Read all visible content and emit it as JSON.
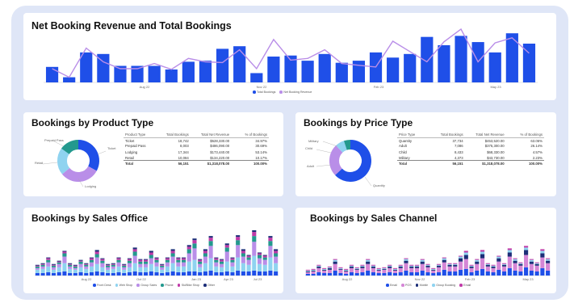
{
  "colors": {
    "blue": "#1f4fe8",
    "lavender": "#b98ee8",
    "teal": "#23998e",
    "lightblue": "#8fd3f0",
    "magenta": "#c03aa8",
    "navy": "#1c2e78",
    "orchid": "#d586d6"
  },
  "revenue": {
    "title": "Net Booking Revenue and Total Bookings",
    "y_left": [
      "",
      ""
    ],
    "y_right": [
      "",
      "",
      ""
    ],
    "x_ticks": [
      "Aug 22",
      "Nov 22",
      "Feb 23",
      "May 23"
    ],
    "legend": [
      "Total Bookings",
      "Net Booking Revenue"
    ],
    "chart_data": {
      "type": "bar",
      "series": [
        {
          "name": "Total Bookings",
          "values": [
            30,
            10,
            58,
            55,
            32,
            32,
            32,
            25,
            40,
            42,
            65,
            70,
            18,
            50,
            52,
            42,
            55,
            38,
            42,
            58,
            48,
            55,
            88,
            72,
            90,
            78,
            58,
            95,
            75
          ]
        },
        {
          "name": "Net Booking Revenue",
          "values": [
            40,
            15,
            100,
            60,
            40,
            40,
            55,
            38,
            70,
            60,
            58,
            95,
            40,
            125,
            65,
            70,
            95,
            55,
            50,
            45,
            120,
            90,
            60,
            118,
            155,
            60,
            115,
            130,
            85
          ]
        }
      ]
    }
  },
  "product": {
    "title": "Bookings by Product Type",
    "headers": [
      "Product Type",
      "Total Bookings",
      "Total Net Revenue",
      "% of Bookings"
    ],
    "rows": [
      [
        "Ticket",
        "18,742",
        "$528,330.00",
        "34.97%"
      ],
      [
        "Prepaid Pass",
        "8,003",
        "$486,090.00",
        "30.69%"
      ],
      [
        "Lodging",
        "17,344",
        "$173,440.00",
        "53.14%"
      ],
      [
        "Retail",
        "10,084",
        "$134,220.00",
        "10.17%"
      ]
    ],
    "total": [
      "Total",
      "56,151",
      "$1,318,078.00",
      "100.00%"
    ],
    "donut_labels": [
      "Prepaid Pass",
      "Ticket",
      "Retail",
      "Lodging"
    ],
    "chart_data": {
      "type": "pie",
      "categories": [
        "Ticket",
        "Lodging",
        "Retail",
        "Prepaid Pass"
      ],
      "values": [
        33,
        31,
        21,
        15
      ]
    }
  },
  "price": {
    "title": "Bookings by Price Type",
    "headers": [
      "Price Type",
      "Total Bookings",
      "Total Net Revenue",
      "% of Bookings"
    ],
    "rows": [
      [
        "Quantity",
        "37,734",
        "$453,520.00",
        "63.06%"
      ],
      [
        "Adult",
        "7,086",
        "$375,300.00",
        "26.14%"
      ],
      [
        "Child",
        "8,433",
        "$68,330.00",
        "4.57%"
      ],
      [
        "Military",
        "4,373",
        "$43,730.00",
        "2.23%"
      ]
    ],
    "total": [
      "Total",
      "56,151",
      "$1,318,078.00",
      "100.00%"
    ],
    "donut_labels": [
      "Military",
      "Child",
      "Adult",
      "Quantity"
    ],
    "chart_data": {
      "type": "pie",
      "categories": [
        "Quantity",
        "Adult",
        "Child",
        "Military"
      ],
      "values": [
        63,
        25,
        7,
        5
      ]
    }
  },
  "office": {
    "title": "Bookings by Sales Office",
    "y_ticks": [
      "",
      "",
      ""
    ],
    "x_ticks": [
      "Aug 22",
      "Oct 22",
      "Jan 23",
      "Apr 23",
      "Jul 23"
    ],
    "legend": [
      "Front Desk",
      "Web Shop",
      "Group Sales",
      "Phone",
      "Ski/Bike Shop",
      "Other"
    ],
    "chart_data": {
      "type": "bar",
      "stacked": true,
      "categories_count": 45,
      "series": [
        {
          "name": "Front Desk",
          "values": [
            3,
            3,
            4,
            3,
            4,
            5,
            3,
            3,
            4,
            3,
            4,
            5,
            4,
            3,
            3,
            4,
            3,
            4,
            5,
            4,
            4,
            5,
            4,
            3,
            4,
            5,
            4,
            4,
            5,
            5,
            4,
            5,
            6,
            4,
            4,
            5,
            4,
            6,
            5,
            5,
            6,
            5,
            5,
            6,
            5
          ]
        },
        {
          "name": "Web Shop",
          "values": [
            4,
            5,
            7,
            4,
            6,
            10,
            5,
            4,
            6,
            5,
            7,
            9,
            6,
            4,
            5,
            7,
            4,
            6,
            10,
            6,
            6,
            9,
            7,
            4,
            7,
            10,
            7,
            7,
            12,
            14,
            6,
            10,
            15,
            7,
            6,
            12,
            7,
            16,
            10,
            8,
            18,
            9,
            8,
            16,
            10
          ]
        },
        {
          "name": "Group Sales",
          "values": [
            2,
            3,
            5,
            3,
            4,
            8,
            3,
            2,
            4,
            3,
            5,
            8,
            5,
            3,
            3,
            5,
            3,
            5,
            9,
            4,
            4,
            7,
            5,
            3,
            5,
            8,
            5,
            5,
            10,
            14,
            4,
            8,
            15,
            5,
            4,
            12,
            5,
            15,
            8,
            6,
            17,
            7,
            6,
            14,
            8
          ]
        },
        {
          "name": "Phone",
          "values": [
            2,
            2,
            3,
            2,
            2,
            4,
            2,
            2,
            3,
            2,
            3,
            4,
            3,
            2,
            2,
            3,
            2,
            3,
            5,
            3,
            3,
            4,
            3,
            2,
            3,
            4,
            3,
            3,
            5,
            6,
            3,
            4,
            6,
            3,
            3,
            5,
            3,
            6,
            4,
            3,
            7,
            4,
            3,
            6,
            4
          ]
        },
        {
          "name": "Ski/Bike Shop",
          "values": [
            1,
            1,
            2,
            1,
            1,
            2,
            1,
            1,
            1,
            1,
            2,
            3,
            2,
            1,
            1,
            2,
            1,
            2,
            3,
            2,
            2,
            3,
            2,
            1,
            2,
            3,
            2,
            2,
            3,
            4,
            2,
            3,
            4,
            2,
            2,
            3,
            2,
            4,
            3,
            2,
            5,
            2,
            2,
            4,
            3
          ]
        },
        {
          "name": "Other",
          "values": [
            1,
            1,
            1,
            1,
            1,
            1,
            1,
            1,
            1,
            1,
            1,
            2,
            1,
            1,
            1,
            1,
            1,
            1,
            2,
            1,
            1,
            2,
            1,
            1,
            1,
            2,
            1,
            1,
            2,
            2,
            1,
            2,
            2,
            1,
            1,
            2,
            1,
            2,
            2,
            1,
            2,
            1,
            1,
            2,
            2
          ]
        }
      ]
    }
  },
  "channel": {
    "title": "Bookings by Sales Channel",
    "y_ticks": [
      "",
      "",
      ""
    ],
    "x_ticks": [
      "Aug 22",
      "Nov 22",
      "Feb 23",
      "May 23"
    ],
    "legend": [
      "Email",
      "POS",
      "Mobile",
      "Group Booking",
      "Email"
    ],
    "chart_data": {
      "type": "bar",
      "stacked": true,
      "categories_count": 45,
      "series": [
        {
          "name": "Email",
          "values": [
            2,
            2,
            4,
            3,
            3,
            6,
            3,
            2,
            4,
            3,
            4,
            6,
            4,
            3,
            3,
            4,
            3,
            4,
            6,
            4,
            4,
            6,
            4,
            3,
            4,
            7,
            5,
            5,
            7,
            8,
            4,
            6,
            8,
            5,
            4,
            7,
            5,
            9,
            6,
            5,
            10,
            6,
            5,
            9,
            6
          ]
        },
        {
          "name": "POS",
          "values": [
            2,
            3,
            5,
            3,
            4,
            8,
            4,
            3,
            5,
            4,
            5,
            8,
            5,
            3,
            4,
            5,
            3,
            5,
            9,
            5,
            5,
            8,
            6,
            3,
            6,
            9,
            6,
            6,
            10,
            12,
            5,
            8,
            13,
            6,
            5,
            10,
            6,
            14,
            9,
            7,
            15,
            8,
            7,
            13,
            9
          ]
        },
        {
          "name": "Mobile",
          "values": [
            1,
            1,
            2,
            1,
            2,
            3,
            1,
            1,
            2,
            1,
            2,
            3,
            2,
            1,
            1,
            2,
            1,
            2,
            3,
            2,
            2,
            3,
            2,
            1,
            2,
            3,
            2,
            2,
            4,
            5,
            2,
            3,
            5,
            2,
            2,
            4,
            2,
            5,
            3,
            2,
            6,
            3,
            2,
            5,
            3
          ]
        },
        {
          "name": "Group Booking",
          "values": [
            1,
            1,
            1,
            1,
            1,
            2,
            1,
            1,
            1,
            1,
            1,
            2,
            1,
            1,
            1,
            1,
            1,
            1,
            2,
            1,
            1,
            2,
            1,
            1,
            1,
            2,
            1,
            1,
            2,
            3,
            1,
            2,
            3,
            1,
            1,
            2,
            1,
            3,
            2,
            1,
            3,
            2,
            1,
            3,
            2
          ]
        },
        {
          "name": "Email",
          "values": [
            1,
            1,
            1,
            1,
            1,
            1,
            1,
            1,
            1,
            1,
            1,
            1,
            1,
            1,
            1,
            1,
            1,
            1,
            1,
            1,
            1,
            1,
            1,
            1,
            1,
            1,
            1,
            1,
            1,
            2,
            1,
            1,
            2,
            1,
            1,
            1,
            1,
            2,
            1,
            1,
            2,
            1,
            1,
            2,
            1
          ]
        }
      ]
    }
  }
}
